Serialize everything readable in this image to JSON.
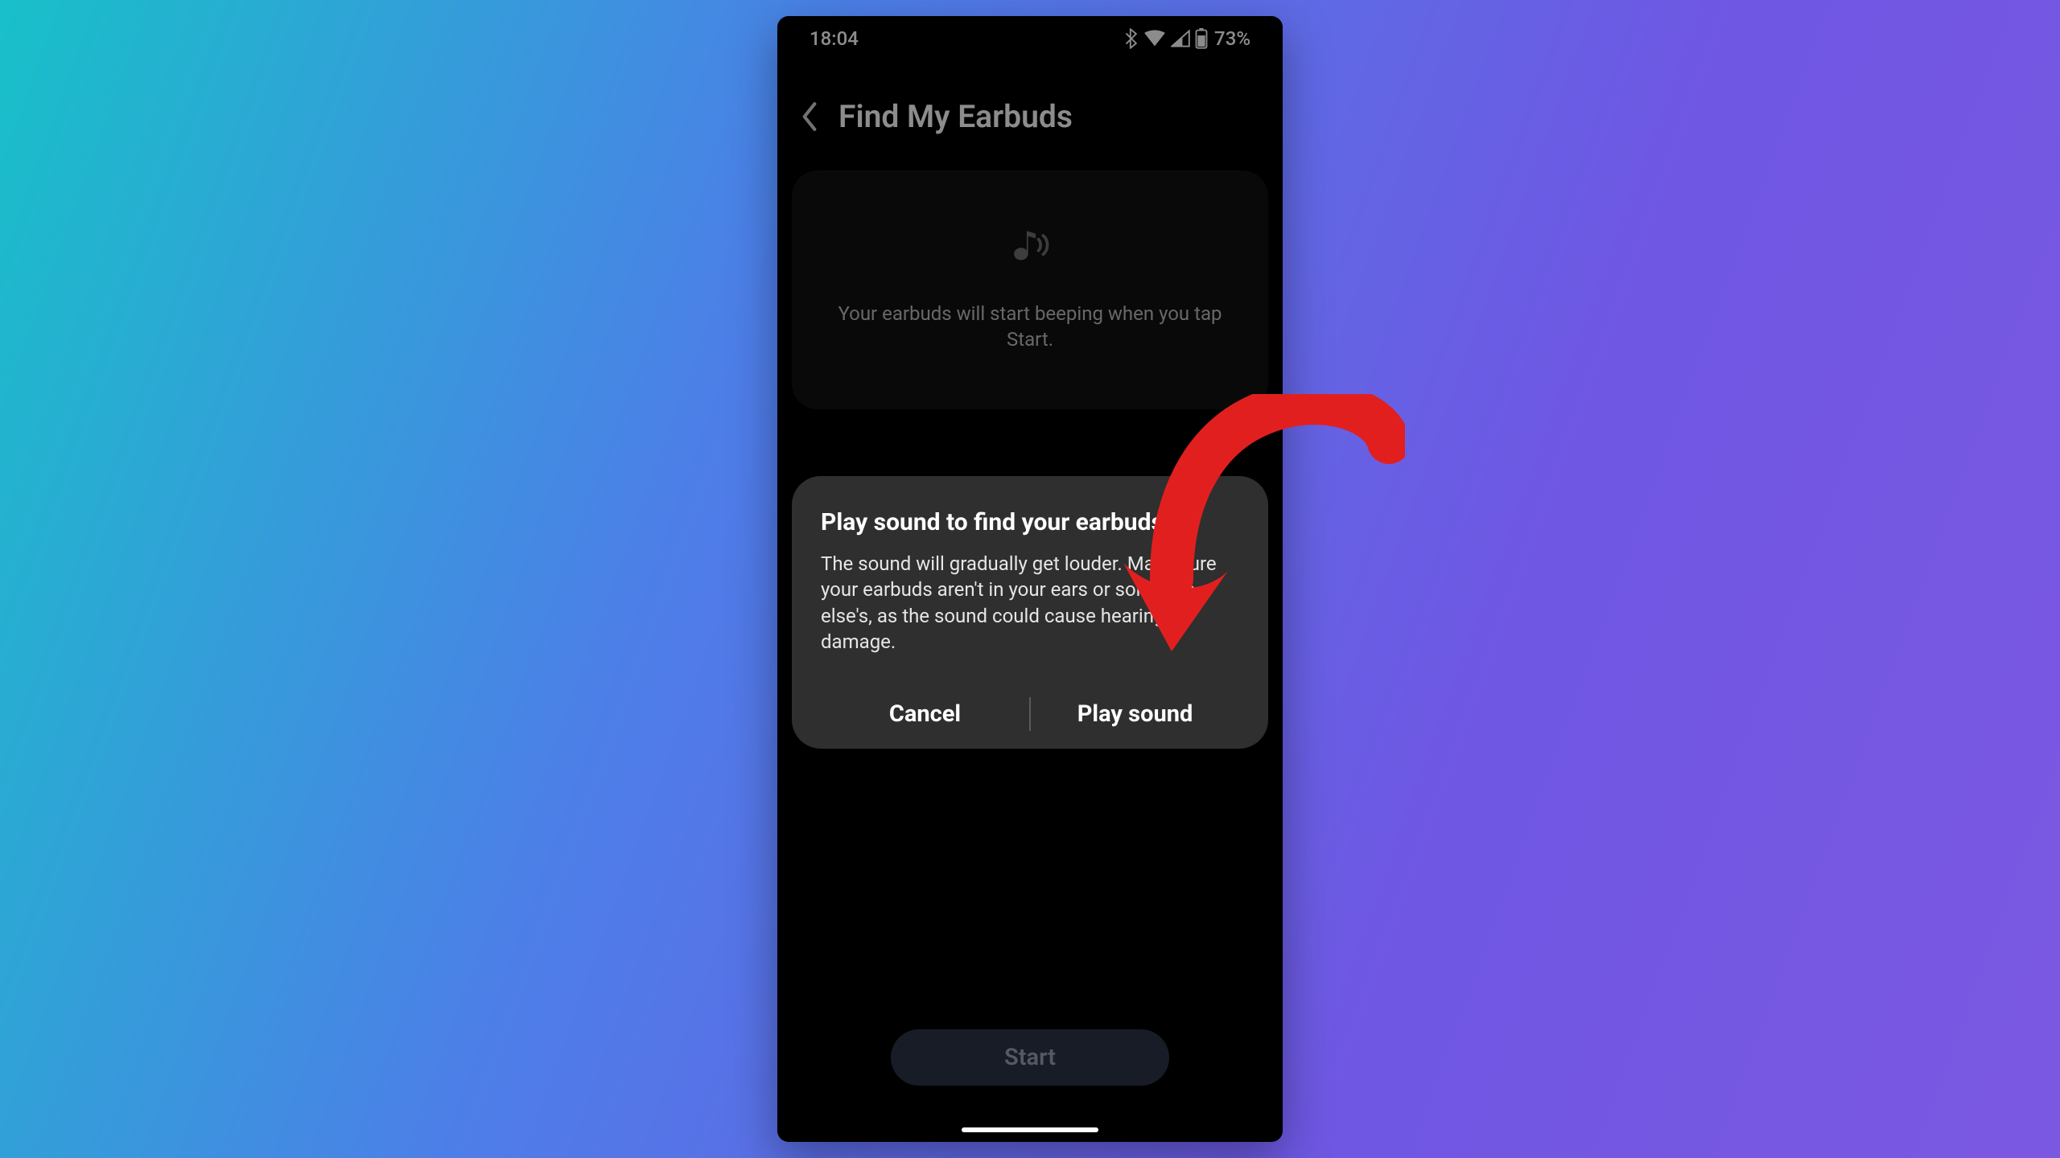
{
  "status": {
    "time": "18:04",
    "battery": "73%"
  },
  "header": {
    "title": "Find My Earbuds"
  },
  "card": {
    "hint": "Your earbuds will start beeping when you tap Start."
  },
  "dialog": {
    "title": "Play sound to find your earbuds",
    "body": "The sound will gradually get louder. Make sure your earbuds aren't in your ears or someone else's, as the sound could cause hearing damage.",
    "cancel": "Cancel",
    "confirm": "Play sound"
  },
  "main": {
    "start": "Start"
  },
  "annotation": {
    "target": "play-sound-button",
    "color": "#e21f1f"
  }
}
